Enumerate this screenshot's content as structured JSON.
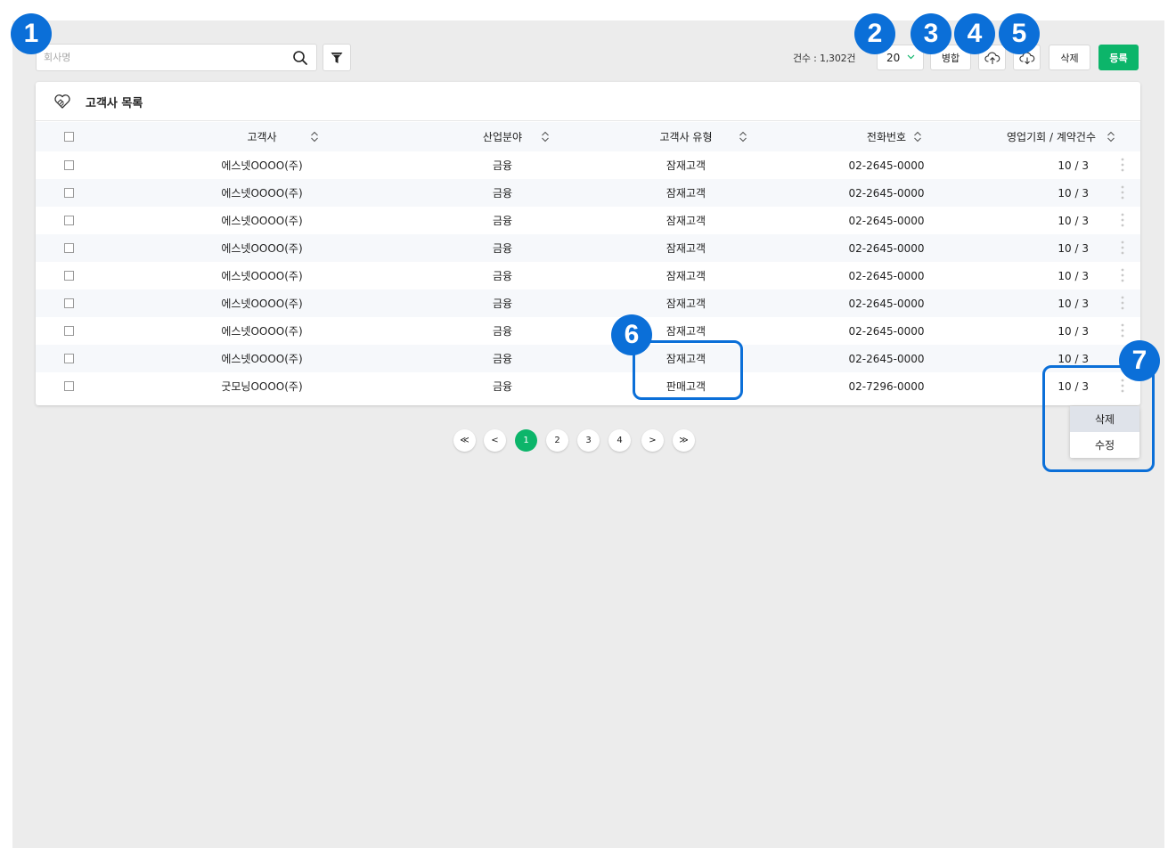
{
  "search": {
    "placeholder": "회사명"
  },
  "toolbar": {
    "count_label": "건수 : 1,302건",
    "page_size": "20",
    "merge_label": "병합",
    "delete_label": "삭제",
    "register_label": "등록"
  },
  "panel": {
    "title": "고객사 목록"
  },
  "table": {
    "headers": [
      "고객사",
      "산업분야",
      "고객사 유형",
      "전화번호",
      "영업기회 / 계약건수"
    ],
    "rows": [
      [
        "에스넷OOOO(주)",
        "금융",
        "잠재고객",
        "02-2645-0000",
        "10 / 3"
      ],
      [
        "에스넷OOOO(주)",
        "금융",
        "잠재고객",
        "02-2645-0000",
        "10 / 3"
      ],
      [
        "에스넷OOOO(주)",
        "금융",
        "잠재고객",
        "02-2645-0000",
        "10 / 3"
      ],
      [
        "에스넷OOOO(주)",
        "금융",
        "잠재고객",
        "02-2645-0000",
        "10 / 3"
      ],
      [
        "에스넷OOOO(주)",
        "금융",
        "잠재고객",
        "02-2645-0000",
        "10 / 3"
      ],
      [
        "에스넷OOOO(주)",
        "금융",
        "잠재고객",
        "02-2645-0000",
        "10 / 3"
      ],
      [
        "에스넷OOOO(주)",
        "금융",
        "잠재고객",
        "02-2645-0000",
        "10 / 3"
      ],
      [
        "에스넷OOOO(주)",
        "금융",
        "잠재고객",
        "02-2645-0000",
        "10 / 3"
      ],
      [
        "굿모닝OOOO(주)",
        "금융",
        "판매고객",
        "02-7296-0000",
        "10 / 3"
      ]
    ]
  },
  "context_menu": {
    "items": [
      "삭제",
      "수정"
    ]
  },
  "pagination": {
    "first": "≪",
    "prev": "<",
    "pages": [
      "1",
      "2",
      "3",
      "4"
    ],
    "current": "1",
    "next": ">",
    "last": "≫"
  },
  "annotations": [
    "1",
    "2",
    "3",
    "4",
    "5",
    "6",
    "7"
  ],
  "colors": {
    "accent": "#0cb56a",
    "annotation": "#0b6fd8",
    "background": "#ececec"
  },
  "icons": {
    "search": "search-icon",
    "filter": "filter-icon",
    "upload": "cloud-upload-icon",
    "download": "cloud-download-icon",
    "panel": "handshake-heart-icon",
    "more": "more-vertical-icon",
    "sort": "sort-icon"
  }
}
